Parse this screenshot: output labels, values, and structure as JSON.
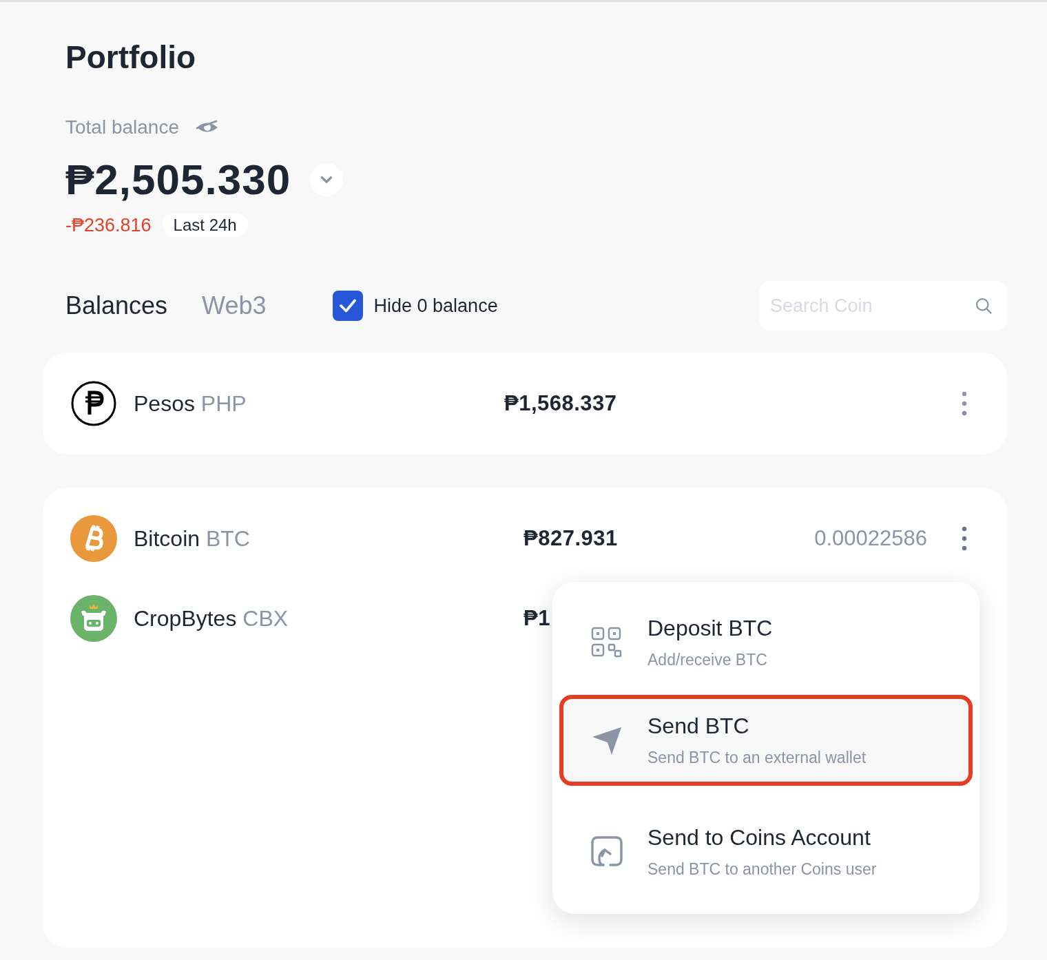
{
  "page": {
    "title": "Portfolio"
  },
  "balance": {
    "label": "Total balance",
    "amount": "₱2,505.330",
    "change": "-₱236.816",
    "period": "Last 24h"
  },
  "tabs": [
    {
      "label": "Balances",
      "selected": true
    },
    {
      "label": "Web3",
      "selected": false
    }
  ],
  "hide_zero": {
    "label": "Hide 0 balance",
    "checked": true
  },
  "search": {
    "placeholder": "Search Coin"
  },
  "fiat": [
    {
      "name": "Pesos",
      "code": "PHP",
      "value": "₱1,568.337"
    }
  ],
  "coins": [
    {
      "name": "Bitcoin",
      "code": "BTC",
      "value": "₱827.931",
      "quantity": "0.00022586"
    },
    {
      "name": "CropBytes",
      "code": "CBX",
      "value": "₱1"
    }
  ],
  "menu": [
    {
      "kind": "deposit",
      "title": "Deposit BTC",
      "subtitle": "Add/receive BTC",
      "highlighted": false
    },
    {
      "kind": "send",
      "title": "Send BTC",
      "subtitle": "Send BTC to an external wallet",
      "highlighted": true
    },
    {
      "kind": "transfer",
      "title": "Send to Coins Account",
      "subtitle": "Send BTC to another Coins user",
      "highlighted": false
    }
  ]
}
